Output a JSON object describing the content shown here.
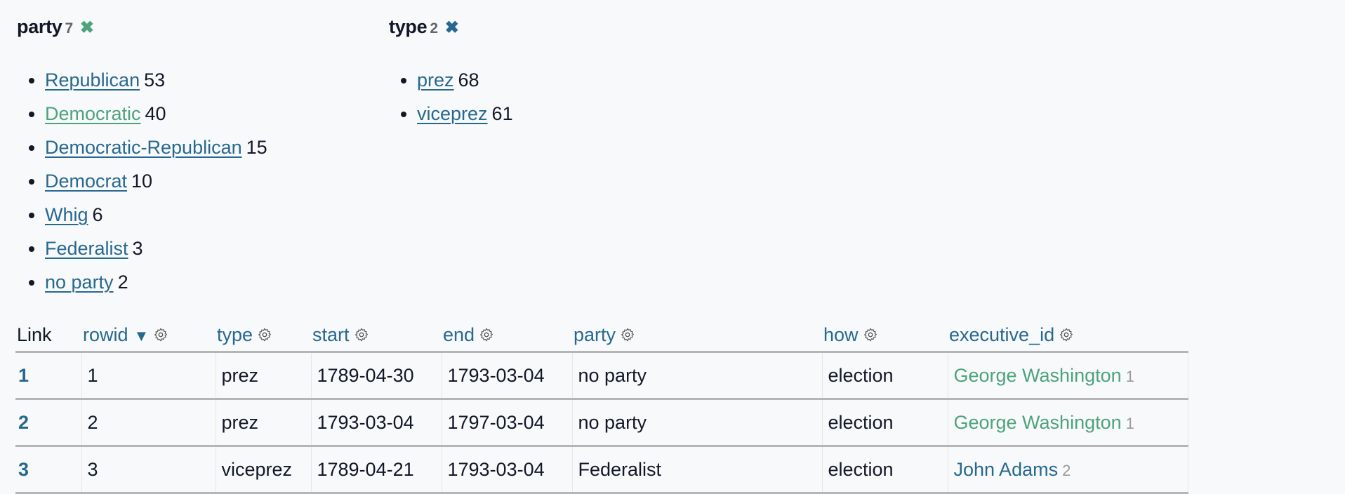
{
  "colors": {
    "link": "#276890",
    "link_active": "#4da37c",
    "close_party": "#4da37c",
    "close_type": "#276890",
    "text": "#111827",
    "muted": "#666666"
  },
  "facets": [
    {
      "name": "party",
      "count": "7",
      "close_icon": "✖",
      "items": [
        {
          "label": "Republican",
          "count": "53",
          "active": false
        },
        {
          "label": "Democratic",
          "count": "40",
          "active": true
        },
        {
          "label": "Democratic-Republican",
          "count": "15",
          "active": false
        },
        {
          "label": "Democrat",
          "count": "10",
          "active": false
        },
        {
          "label": "Whig",
          "count": "6",
          "active": false
        },
        {
          "label": "Federalist",
          "count": "3",
          "active": false
        },
        {
          "label": "no party",
          "count": "2",
          "active": false
        }
      ]
    },
    {
      "name": "type",
      "count": "2",
      "close_icon": "✖",
      "items": [
        {
          "label": "prez",
          "count": "68",
          "active": false
        },
        {
          "label": "viceprez",
          "count": "61",
          "active": false
        }
      ]
    }
  ],
  "table": {
    "columns": [
      {
        "label": "Link",
        "sortable": false
      },
      {
        "label": "rowid",
        "sortable": true,
        "sort_indicator": "▼"
      },
      {
        "label": "type",
        "sortable": true
      },
      {
        "label": "start",
        "sortable": true
      },
      {
        "label": "end",
        "sortable": true
      },
      {
        "label": "party",
        "sortable": true
      },
      {
        "label": "how",
        "sortable": true
      },
      {
        "label": "executive_id",
        "sortable": true
      }
    ],
    "rows": [
      {
        "link": "1",
        "rowid": "1",
        "type": "prez",
        "start": "1789-04-30",
        "end": "1793-03-04",
        "party": "no party",
        "how": "election",
        "executive_name": "George Washington",
        "executive_id": "1",
        "executive_active": true
      },
      {
        "link": "2",
        "rowid": "2",
        "type": "prez",
        "start": "1793-03-04",
        "end": "1797-03-04",
        "party": "no party",
        "how": "election",
        "executive_name": "George Washington",
        "executive_id": "1",
        "executive_active": true
      },
      {
        "link": "3",
        "rowid": "3",
        "type": "viceprez",
        "start": "1789-04-21",
        "end": "1793-03-04",
        "party": "Federalist",
        "how": "election",
        "executive_name": "John Adams",
        "executive_id": "2",
        "executive_active": false
      }
    ]
  }
}
